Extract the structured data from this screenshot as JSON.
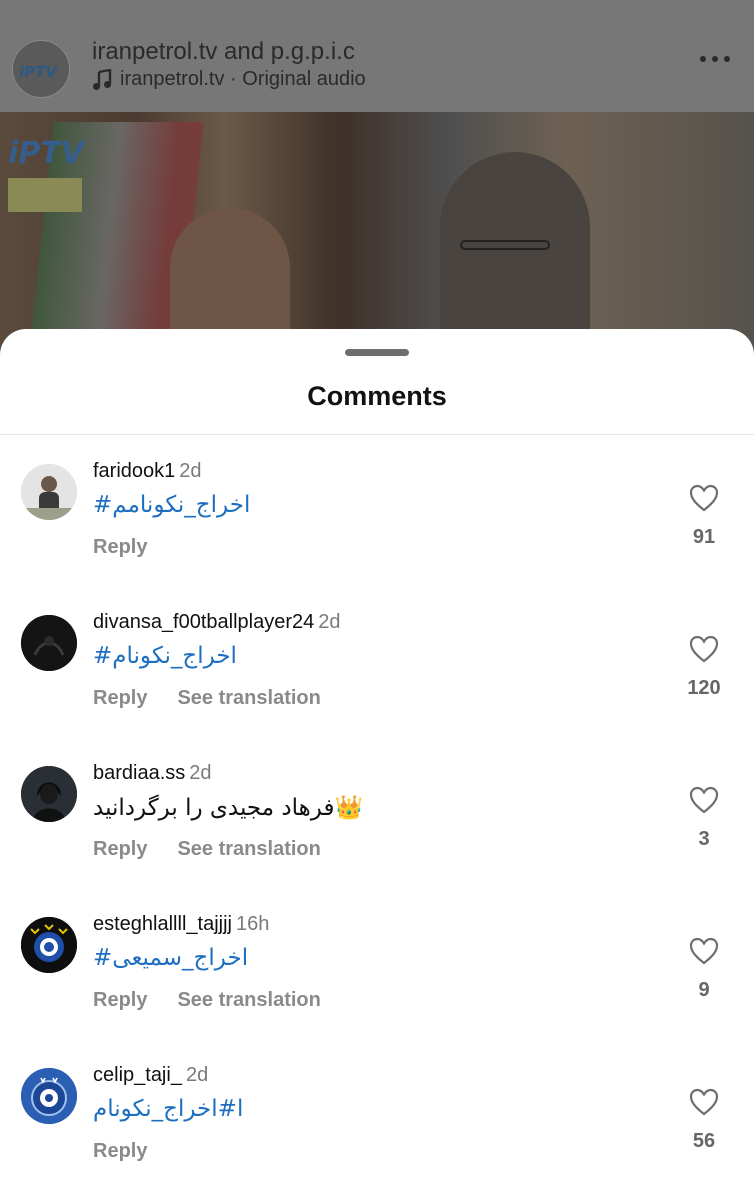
{
  "reel": {
    "title": "iranpetrol.tv and p.g.p.i.c",
    "audio": "iranpetrol.tv · Original audio",
    "avatar_text": "iPTV",
    "banner_text": "iPTV"
  },
  "sheet": {
    "title": "Comments"
  },
  "comments": [
    {
      "user": "faridook1",
      "time": "2d",
      "text": "#اخراج_نکونامم",
      "is_tag": true,
      "actions": [
        "Reply"
      ],
      "likes": "91"
    },
    {
      "user": "divansa_f00tballplayer24",
      "time": "2d",
      "text": "#اخراج_نکونام",
      "is_tag": true,
      "actions": [
        "Reply",
        "See translation"
      ],
      "likes": "120"
    },
    {
      "user": "bardiaa.ss",
      "time": "2d",
      "text": "فرهاد مجیدی را برگردانید👑",
      "is_tag": false,
      "actions": [
        "Reply",
        "See translation"
      ],
      "likes": "3"
    },
    {
      "user": "esteghlallll_tajjjj",
      "time": "16h",
      "text": "#اخراج_سمیعی",
      "is_tag": true,
      "actions": [
        "Reply",
        "See translation"
      ],
      "likes": "9"
    },
    {
      "user": "celip_taji_",
      "time": "2d",
      "text": "ا#اخراج_نکونام",
      "is_tag": true,
      "actions": [
        "Reply"
      ],
      "likes": "56"
    }
  ],
  "colors": {
    "hashtag": "#1e6fc0",
    "muted": "#8a8a8a",
    "backdrop": "#6b6b6b"
  },
  "icons": {
    "like": "heart-outline-icon",
    "audio": "music-note-icon",
    "menu": "more-horizontal-icon"
  }
}
